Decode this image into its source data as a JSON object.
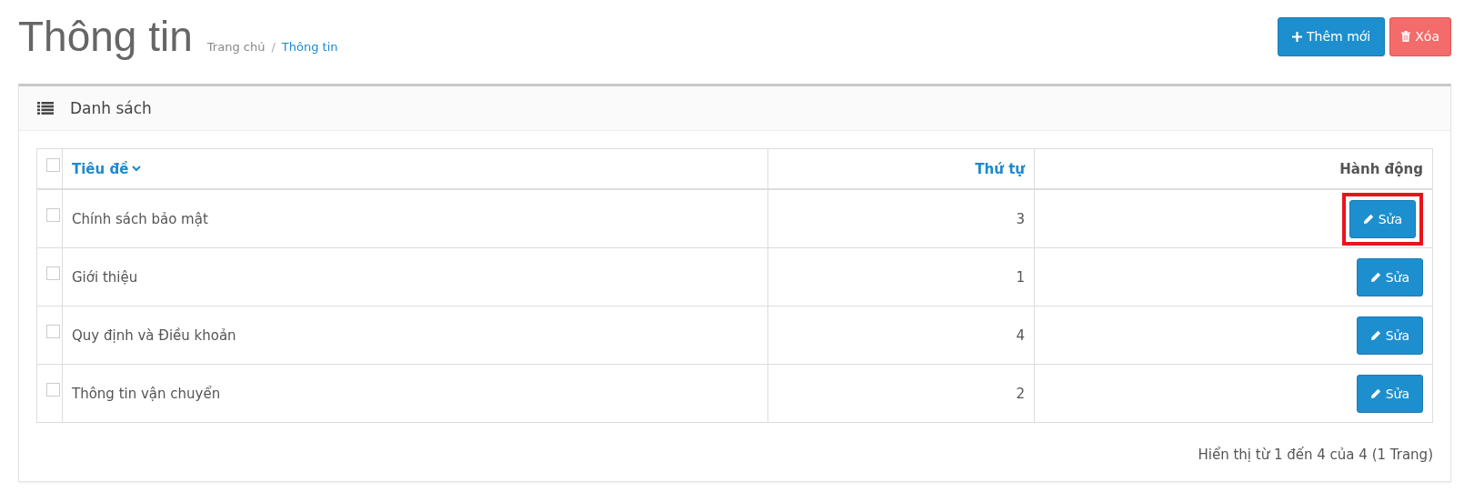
{
  "page": {
    "title": "Thông tin",
    "breadcrumb_separator": "/",
    "breadcrumb": [
      {
        "label": "Trang chủ",
        "current": false
      },
      {
        "label": "Thông tin",
        "current": true
      }
    ]
  },
  "actions": [
    {
      "kind": "add",
      "label": "Thêm mới"
    },
    {
      "kind": "delete",
      "label": "Xóa"
    }
  ],
  "panel": {
    "title": "Danh sách"
  },
  "table": {
    "columns": [
      {
        "label": "Tiêu đề",
        "sortable": true
      },
      {
        "label": "Thứ tự",
        "sortable": true
      },
      {
        "label": "Hành động",
        "sortable": false
      }
    ],
    "select_all_checked": false,
    "rows": [
      {
        "title": "Chính sách bảo mật",
        "order": "3",
        "action": "Sửa",
        "checked": false,
        "highlighted": true
      },
      {
        "title": "Giới thiệu",
        "order": "1",
        "action": "Sửa",
        "checked": false,
        "highlighted": false
      },
      {
        "title": "Quy định và Điều khoản",
        "order": "4",
        "action": "Sửa",
        "checked": false,
        "highlighted": false
      },
      {
        "title": "Thông tin vận chuyển",
        "order": "2",
        "action": "Sửa",
        "checked": false,
        "highlighted": false
      }
    ]
  },
  "pagination_info": "Hiển thị từ 1 đến 4 của 4 (1 Trang)"
}
